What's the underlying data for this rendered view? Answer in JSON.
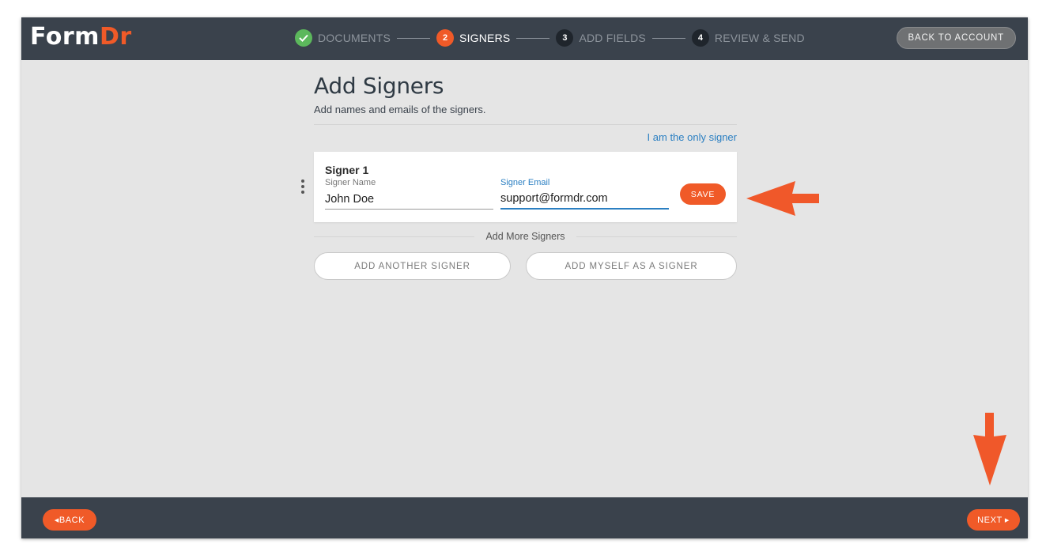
{
  "brand": {
    "part1": "Form",
    "part2": "Dr"
  },
  "steps": [
    {
      "number": "",
      "label": "DOCUMENTS",
      "state": "done"
    },
    {
      "number": "2",
      "label": "SIGNERS",
      "state": "active"
    },
    {
      "number": "3",
      "label": "ADD FIELDS",
      "state": "todo"
    },
    {
      "number": "4",
      "label": "REVIEW & SEND",
      "state": "todo"
    }
  ],
  "header": {
    "back_to_account": "BACK TO ACCOUNT"
  },
  "page": {
    "title": "Add Signers",
    "subtitle": "Add names and emails of the signers.",
    "only_signer_link": "I am the only signer"
  },
  "signer": {
    "title": "Signer 1",
    "name_label": "Signer Name",
    "name_value": "John Doe",
    "email_label": "Signer Email",
    "email_value": "support@formdr.com",
    "save_label": "SAVE"
  },
  "more": {
    "label": "Add More Signers",
    "add_another": "ADD ANOTHER SIGNER",
    "add_myself": "ADD MYSELF AS A SIGNER"
  },
  "footer": {
    "back_label": "BACK",
    "next_label": "NEXT"
  },
  "colors": {
    "accent": "#f05a28",
    "topbar": "#3a424c",
    "link": "#2b7fc2",
    "done": "#5cb85c"
  }
}
